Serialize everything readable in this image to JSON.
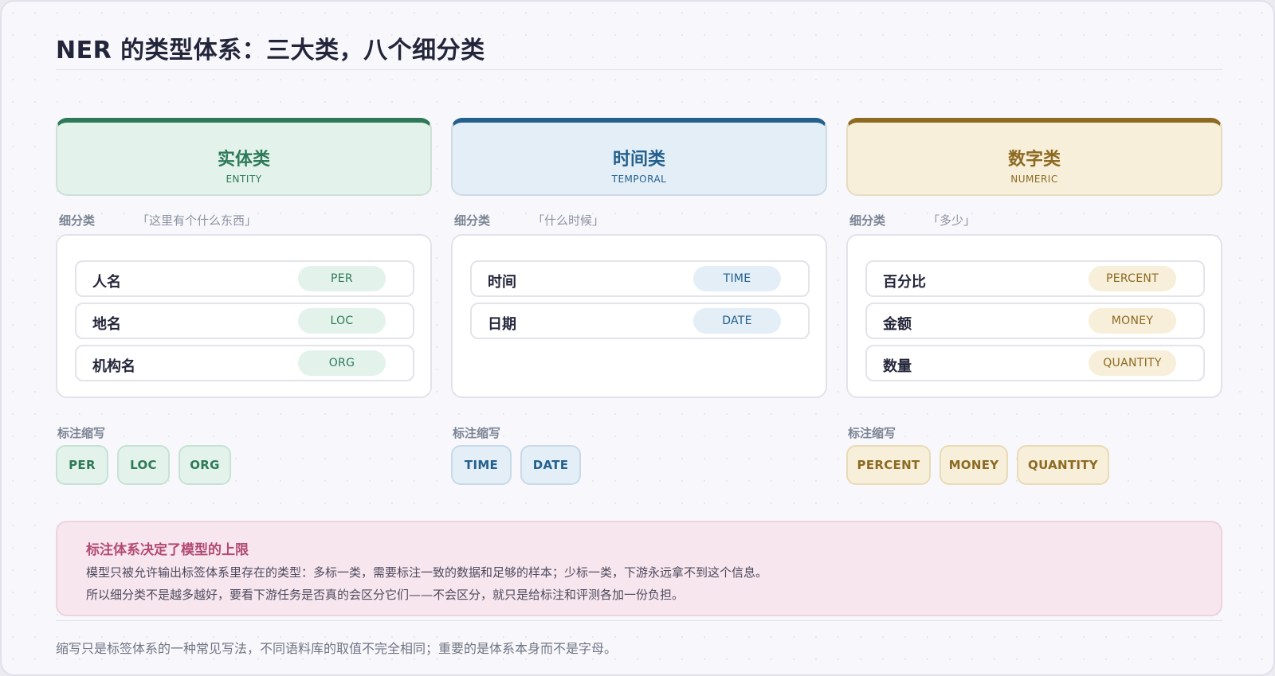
{
  "title": "NER 的类型体系：三大类，八个细分类",
  "subcategory_label": "细分类",
  "abbreviation_label": "标注缩写",
  "categories": [
    {
      "name": "实体类",
      "code": "ENTITY",
      "question": "「这里有个什么东西」",
      "color": "#2e7a58",
      "items": [
        {
          "label": "人名",
          "tag": "PER"
        },
        {
          "label": "地名",
          "tag": "LOC"
        },
        {
          "label": "机构名",
          "tag": "ORG"
        }
      ],
      "abbreviations": [
        "PER",
        "LOC",
        "ORG"
      ]
    },
    {
      "name": "时间类",
      "code": "TEMPORAL",
      "question": "「什么时候」",
      "color": "#24608c",
      "items": [
        {
          "label": "时间",
          "tag": "TIME"
        },
        {
          "label": "日期",
          "tag": "DATE"
        }
      ],
      "abbreviations": [
        "TIME",
        "DATE"
      ]
    },
    {
      "name": "数字类",
      "code": "NUMERIC",
      "question": "「多少」",
      "color": "#8c6a22",
      "items": [
        {
          "label": "百分比",
          "tag": "PERCENT"
        },
        {
          "label": "金额",
          "tag": "MONEY"
        },
        {
          "label": "数量",
          "tag": "QUANTITY"
        }
      ],
      "abbreviations": [
        "PERCENT",
        "MONEY",
        "QUANTITY"
      ]
    }
  ],
  "note": {
    "title": "标注体系决定了模型的上限",
    "line1": "模型只被允许输出标签体系里存在的类型：多标一类，需要标注一致的数据和足够的样本；少标一类，下游永远拿不到这个信息。",
    "line2": "所以细分类不是越多越好，要看下游任务是否真的会区分它们——不会区分，就只是给标注和评测各加一份负担。",
    "color": "#b24a73"
  },
  "footer": "缩写只是标签体系的一种常见写法，不同语料库的取值不完全相同；重要的是体系本身而不是字母。"
}
